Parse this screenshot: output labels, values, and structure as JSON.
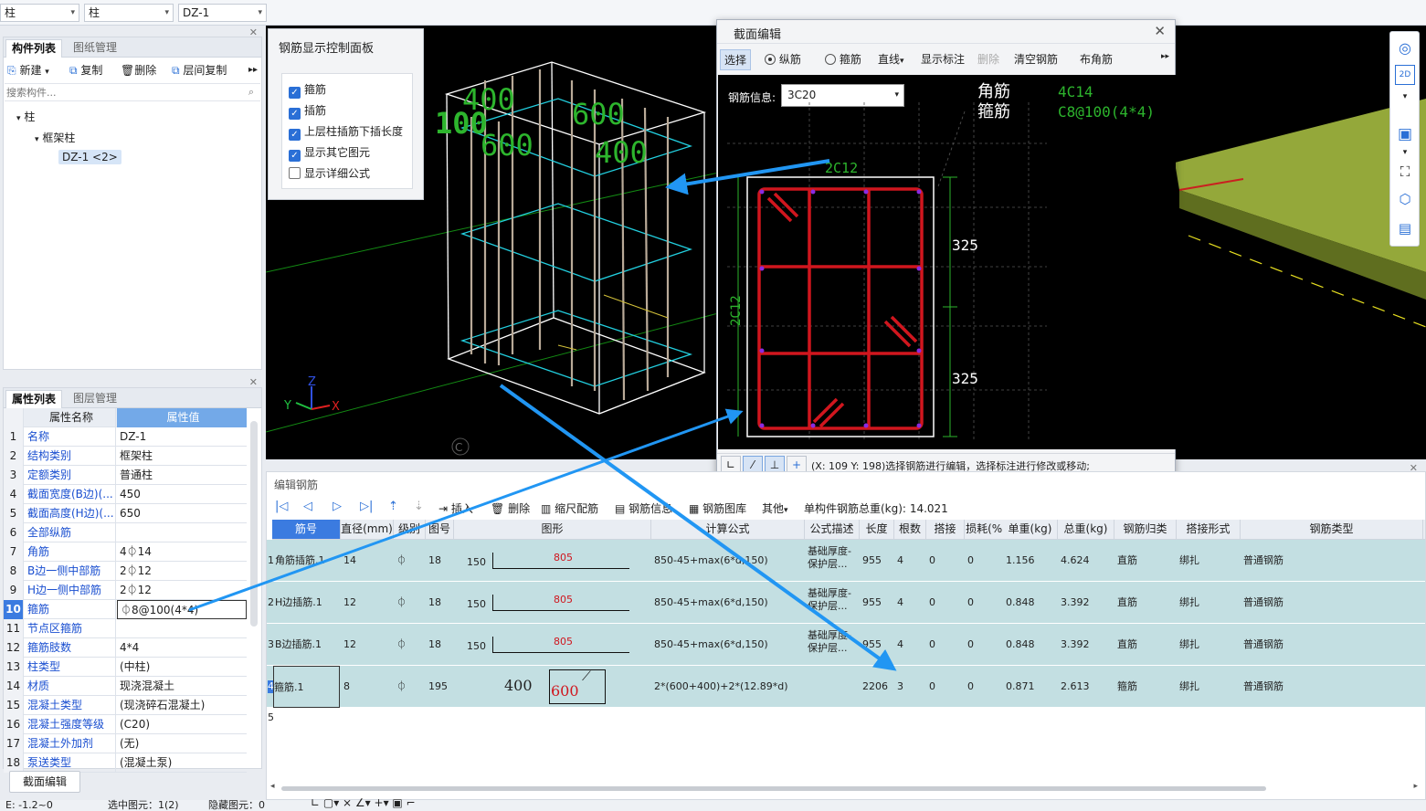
{
  "topbar": {
    "combo1": "柱",
    "combo2": "柱",
    "combo3": "DZ-1"
  },
  "component_panel": {
    "tabs": [
      "构件列表",
      "图纸管理"
    ],
    "toolbar": {
      "new": "新建",
      "copy": "复制",
      "delete": "删除",
      "floor_copy": "层间复制"
    },
    "search_placeholder": "搜索构件...",
    "tree": {
      "root": "柱",
      "child": "框架柱",
      "leaf": "DZ-1 <2>"
    }
  },
  "props_panel": {
    "tabs": [
      "属性列表",
      "图层管理"
    ],
    "headers": [
      "属性名称",
      "属性值"
    ],
    "rows": [
      {
        "n": "1",
        "name": "名称",
        "value": "DZ-1"
      },
      {
        "n": "2",
        "name": "结构类别",
        "value": "框架柱"
      },
      {
        "n": "3",
        "name": "定额类别",
        "value": "普通柱"
      },
      {
        "n": "4",
        "name": "截面宽度(B边)(...",
        "value": "450"
      },
      {
        "n": "5",
        "name": "截面高度(H边)(...",
        "value": "650"
      },
      {
        "n": "6",
        "name": "全部纵筋",
        "value": ""
      },
      {
        "n": "7",
        "name": "角筋",
        "value": "4⏀14"
      },
      {
        "n": "8",
        "name": "B边一侧中部筋",
        "value": "2⏀12"
      },
      {
        "n": "9",
        "name": "H边一侧中部筋",
        "value": "2⏀12"
      },
      {
        "n": "10",
        "name": "箍筋",
        "value": "⏀8@100(4*4)"
      },
      {
        "n": "11",
        "name": "节点区箍筋",
        "value": ""
      },
      {
        "n": "12",
        "name": "箍筋肢数",
        "value": "4*4"
      },
      {
        "n": "13",
        "name": "柱类型",
        "value": "(中柱)"
      },
      {
        "n": "14",
        "name": "材质",
        "value": "现浇混凝土"
      },
      {
        "n": "15",
        "name": "混凝土类型",
        "value": "(现浇碎石混凝土)"
      },
      {
        "n": "16",
        "name": "混凝土强度等级",
        "value": "(C20)"
      },
      {
        "n": "17",
        "name": "混凝土外加剂",
        "value": "(无)"
      },
      {
        "n": "18",
        "name": "泵送类型",
        "value": "(混凝土泵)"
      }
    ],
    "section_edit_button": "截面编辑"
  },
  "rebar_panel": {
    "title": "钢筋显示控制面板",
    "options": [
      {
        "label": "箍筋",
        "checked": true
      },
      {
        "label": "插筋",
        "checked": true
      },
      {
        "label": "上层柱插筋下插长度",
        "checked": true
      },
      {
        "label": "显示其它图元",
        "checked": true
      },
      {
        "label": "显示详细公式",
        "checked": false
      }
    ]
  },
  "viewport": {
    "labels": [
      "400",
      "600",
      "600",
      "400",
      "100"
    ],
    "axis": {
      "x": "X",
      "y": "Y",
      "z": "Z"
    },
    "nav": "C"
  },
  "section_dialog": {
    "title": "截面编辑",
    "toolbar": {
      "select": "选择",
      "longitudinal": "纵筋",
      "stirrup": "箍筋",
      "line": "直线",
      "show_label": "显示标注",
      "delete": "删除",
      "clear": "清空钢筋",
      "corner": "布角筋"
    },
    "rebar_info_label": "钢筋信息:",
    "rebar_info_value": "3C20",
    "legend": {
      "corner_label": "角筋",
      "corner_value": "4C14",
      "stirrup_label": "箍筋",
      "stirrup_value": "C8@100(4*4)"
    },
    "drawing": {
      "top_label": "2C12",
      "side_label": "2C12",
      "dim1": "325",
      "dim2": "325"
    },
    "status": "(X: 109 Y: 198)选择钢筋进行编辑，选择标注进行修改或移动;"
  },
  "editor": {
    "title": "编辑钢筋",
    "toolbar": {
      "insert": "插入",
      "delete": "删除",
      "scale": "缩尺配筋",
      "info": "钢筋信息",
      "library": "钢筋图库",
      "other": "其他",
      "total_label": "单构件钢筋总重(kg):",
      "total_value": "14.021"
    },
    "headers": [
      "筋号",
      "直径(mm)",
      "级别",
      "图号",
      "图形",
      "计算公式",
      "公式描述",
      "长度",
      "根数",
      "搭接",
      "损耗(%)",
      "单重(kg)",
      "总重(kg)",
      "钢筋归类",
      "搭接形式",
      "钢筋类型"
    ],
    "rows": [
      {
        "n": "1",
        "name": "角筋插筋.1",
        "dia": "14",
        "grade": "⏀",
        "fig": "18",
        "s1": "150",
        "s2": "805",
        "formula": "850-45+max(6*d,150)",
        "desc": "基础厚度-保护层...",
        "len": "955",
        "count": "4",
        "lap": "0",
        "loss": "0",
        "unit": "1.156",
        "total": "4.624",
        "cat": "直筋",
        "form": "绑扎",
        "type": "普通钢筋"
      },
      {
        "n": "2",
        "name": "H边插筋.1",
        "dia": "12",
        "grade": "⏀",
        "fig": "18",
        "s1": "150",
        "s2": "805",
        "formula": "850-45+max(6*d,150)",
        "desc": "基础厚度-保护层...",
        "len": "955",
        "count": "4",
        "lap": "0",
        "loss": "0",
        "unit": "0.848",
        "total": "3.392",
        "cat": "直筋",
        "form": "绑扎",
        "type": "普通钢筋"
      },
      {
        "n": "3",
        "name": "B边插筋.1",
        "dia": "12",
        "grade": "⏀",
        "fig": "18",
        "s1": "150",
        "s2": "805",
        "formula": "850-45+max(6*d,150)",
        "desc": "基础厚度-保护层...",
        "len": "955",
        "count": "4",
        "lap": "0",
        "loss": "0",
        "unit": "0.848",
        "total": "3.392",
        "cat": "直筋",
        "form": "绑扎",
        "type": "普通钢筋"
      },
      {
        "n": "4",
        "name": "箍筋.1",
        "dia": "8",
        "grade": "⏀",
        "fig": "195",
        "s1": "400",
        "s2": "600",
        "formula": "2*(600+400)+2*(12.89*d)",
        "desc": "",
        "len": "2206",
        "count": "3",
        "lap": "0",
        "loss": "0",
        "unit": "0.871",
        "total": "2.613",
        "cat": "箍筋",
        "form": "绑扎",
        "type": "普通钢筋"
      },
      {
        "n": "5"
      }
    ]
  },
  "statusbar": {
    "left": "E: -1.2~0",
    "mid1": "选中图元：1(2)",
    "mid2": "隐藏图元：0"
  },
  "colors": {
    "accent": "#2a6fd6",
    "rebar_red": "#d0161e",
    "cyan": "#29d7e6",
    "green_text": "#2db52d",
    "arrow_blue": "#2196f3",
    "row_bg": "#c3dfe2"
  }
}
